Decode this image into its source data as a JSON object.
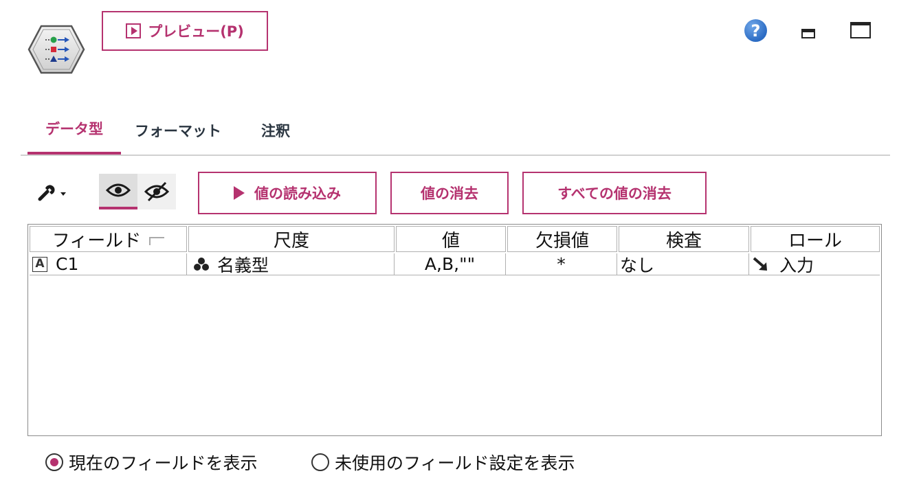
{
  "header": {
    "preview_label": "プレビュー(P)",
    "help_glyph": "?"
  },
  "tabs": [
    {
      "label": "データ型",
      "active": true
    },
    {
      "label": "フォーマット",
      "active": false
    },
    {
      "label": "注釈",
      "active": false
    }
  ],
  "toolbar": {
    "read_values_label": "値の読み込み",
    "clear_values_label": "値の消去",
    "clear_all_values_label": "すべての値の消去"
  },
  "table": {
    "columns": [
      "フィールド",
      "尺度",
      "値",
      "欠損値",
      "検査",
      "ロール"
    ],
    "rows": [
      {
        "type_glyph": "A",
        "field": "C1",
        "measure": "名義型",
        "value": "A,B,\"\"",
        "missing": "*",
        "check": "なし",
        "role": "入力"
      }
    ]
  },
  "radios": {
    "current_fields_label": "現在のフィールドを表示",
    "unused_fields_label": "未使用のフィールド設定を表示",
    "selected": "current"
  },
  "colors": {
    "accent": "#b5326f",
    "help_blue": "#2c6cc4"
  },
  "icons": [
    "type-node-icon",
    "help-icon",
    "minimize-icon",
    "maximize-icon",
    "wrench-icon",
    "eye-icon",
    "eye-slash-icon",
    "play-icon",
    "text-type-icon",
    "nominal-measure-icon",
    "input-role-arrow-icon"
  ]
}
